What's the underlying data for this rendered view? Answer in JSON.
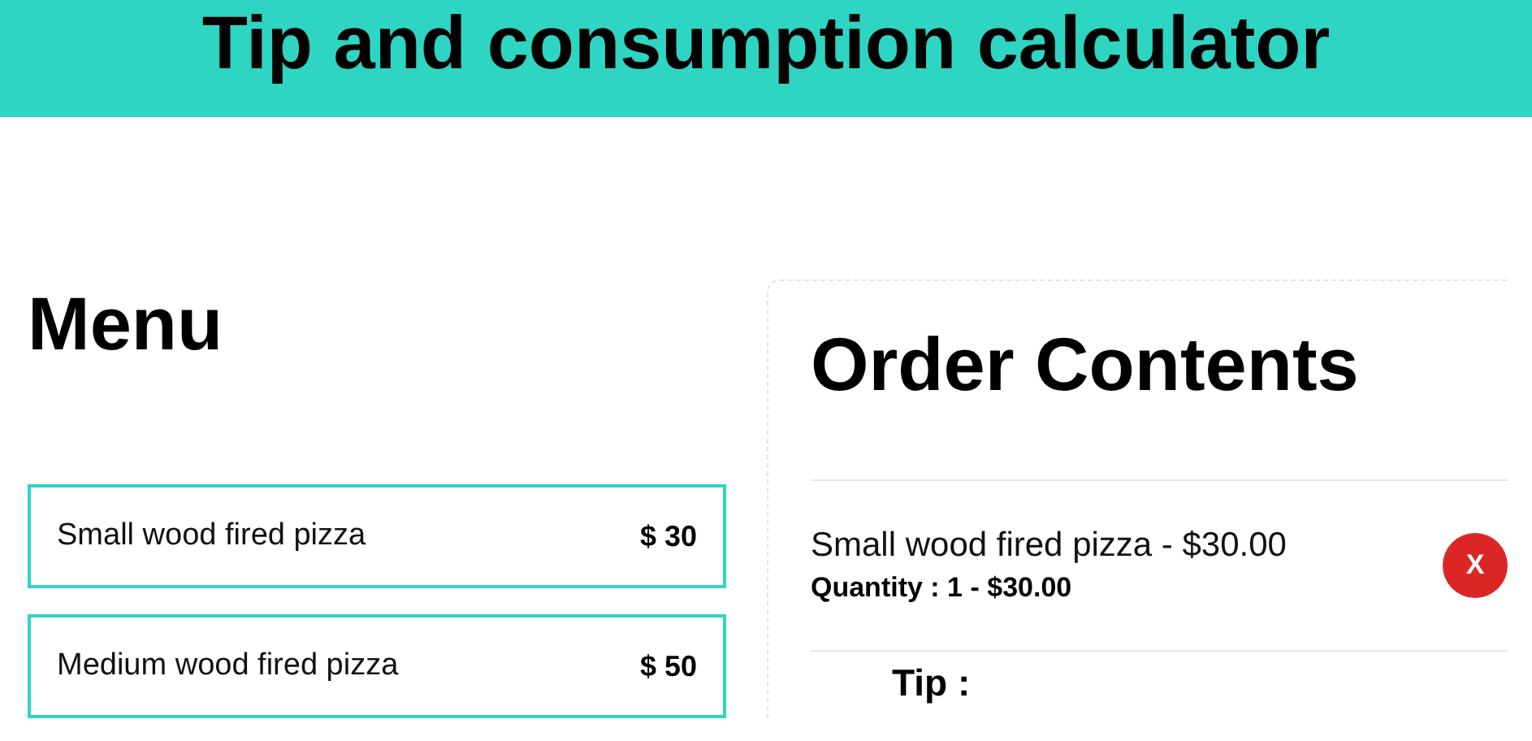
{
  "header": {
    "title": "Tip and consumption calculator"
  },
  "menu": {
    "heading": "Menu",
    "items": [
      {
        "name": "Small wood fired pizza",
        "price": "$ 30"
      },
      {
        "name": "Medium wood fired pizza",
        "price": "$ 50"
      }
    ]
  },
  "order": {
    "heading": "Order Contents",
    "items": [
      {
        "name": "Small wood fired pizza - $30.00",
        "quantity": "Quantity : 1 - $30.00",
        "remove": "X"
      }
    ],
    "tip_label": "Tip :"
  }
}
